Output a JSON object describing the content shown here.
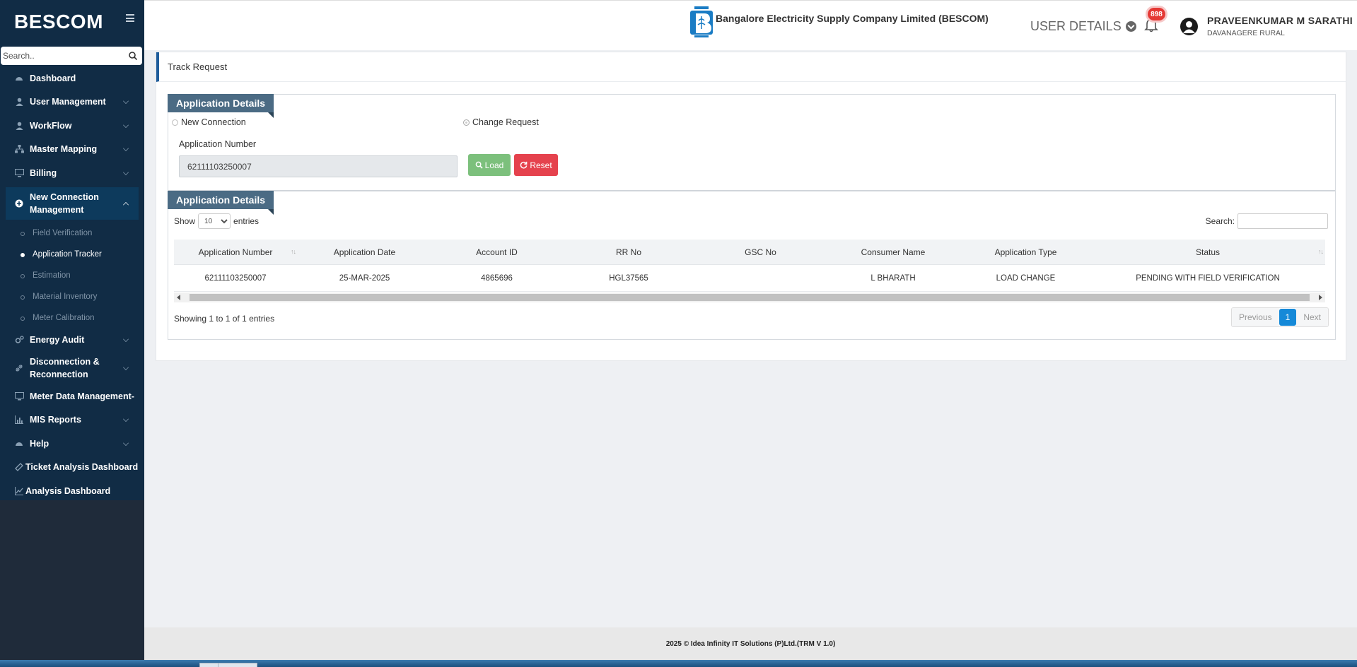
{
  "app": {
    "brand": "BESCOM",
    "company": "Bangalore Electricity Supply Company Limited (BESCOM)"
  },
  "sidebar": {
    "search_placeholder": "Search..",
    "items": [
      {
        "label": "Dashboard"
      },
      {
        "label": "User Management"
      },
      {
        "label": "WorkFlow"
      },
      {
        "label": "Master Mapping"
      },
      {
        "label": "Billing"
      },
      {
        "label": "New Connection Management"
      },
      {
        "label": "Energy Audit"
      },
      {
        "label": "Disconnection & Reconnection"
      },
      {
        "label": "Meter Data Management-"
      },
      {
        "label": "MIS Reports"
      },
      {
        "label": "Help"
      },
      {
        "label": "Ticket Analysis Dashboard"
      },
      {
        "label": "Analysis Dashboard"
      }
    ],
    "sub_items": [
      {
        "label": "Field Verification"
      },
      {
        "label": "Application Tracker"
      },
      {
        "label": "Estimation"
      },
      {
        "label": "Material Inventory"
      },
      {
        "label": "Meter Calibration"
      }
    ]
  },
  "header": {
    "user_details": "USER DETAILS",
    "notifications": "898",
    "user_name": "PRAVEENKUMAR M SARATHI",
    "user_region": "DAVANAGERE RURAL"
  },
  "page": {
    "title": "Track Request",
    "section1": "Application Details",
    "section2": "Application Details",
    "radio_new": "New Connection",
    "radio_change": "Change Request",
    "app_number_label": "Application Number",
    "app_number_value": "62111103250007",
    "load_label": "Load",
    "reset_label": "Reset"
  },
  "table": {
    "show_label": "Show",
    "entries_value": "10",
    "entries_label": "entries",
    "search_label": "Search:",
    "columns": [
      "Application Number",
      "Application Date",
      "Account ID",
      "RR No",
      "GSC No",
      "Consumer Name",
      "Application Type",
      "Status"
    ],
    "rows": [
      [
        "62111103250007",
        "25-MAR-2025",
        "4865696",
        "HGL37565",
        "",
        "L BHARATH",
        "LOAD CHANGE",
        "PENDING WITH FIELD VERIFICATION"
      ]
    ],
    "showing": "Showing 1 to 1 of 1 entries",
    "pager": {
      "previous": "Previous",
      "current": "1",
      "next": "Next"
    }
  },
  "footer": {
    "text": "2025 © Idea Infinity IT Solutions (P)Ltd.(TRM V 1.0)"
  },
  "colors": {
    "sidebar": "#112c45",
    "section_tag": "#4b6b84",
    "load": "#7cc07c",
    "reset": "#e5424d",
    "page_active": "#1589d8"
  }
}
